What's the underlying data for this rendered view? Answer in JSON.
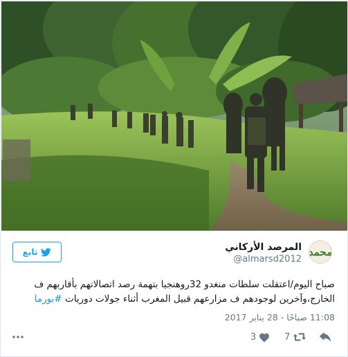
{
  "tweet": {
    "display_name": "المرصد الأركاني",
    "handle": "@almarsd2012",
    "avatar_glyph": "محمد",
    "follow_label": "تابع",
    "text_main": "صباح اليوم/اعتقلت سلطات منغدو 32روهنجيا بتهمة رصد اتصالاتهم بأقاربهم ف الخارج،وآخرين لوجودهم ف مزارعهم قبيل المغرب أثناء جولات دوريات ",
    "hashtag": "#بورما",
    "timestamp": "11:08 صباحًا - 28 يناير 2017",
    "likes": "3",
    "retweets": "7"
  },
  "icons": {
    "follow": "bird-icon",
    "like": "heart-icon",
    "retweet": "retweet-icon",
    "reply": "reply-icon",
    "more": "more-dots-icon"
  },
  "colors": {
    "accent": "#1da1f2",
    "hashtag": "#1b95e0",
    "secondary_text": "#657786",
    "border": "#e1e8ed"
  }
}
